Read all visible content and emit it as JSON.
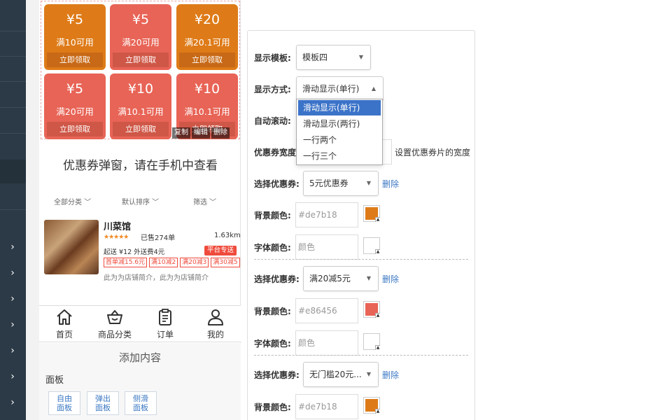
{
  "sidebar": {
    "chevrons": [
      "›",
      "›",
      "›",
      "›",
      "›",
      "›",
      "›",
      "›"
    ]
  },
  "coupons": [
    {
      "amount": "¥5",
      "condition": "满10可用",
      "button": "立即领取",
      "color": "#de7b18"
    },
    {
      "amount": "¥5",
      "condition": "满20可用",
      "button": "立即领取",
      "color": "#e86456"
    },
    {
      "amount": "¥20",
      "condition": "满20.1可用",
      "button": "立即领取",
      "color": "#de7b18"
    },
    {
      "amount": "¥5",
      "condition": "满20可用",
      "button": "立即领取",
      "color": "#e86456"
    },
    {
      "amount": "¥10",
      "condition": "满10.1可用",
      "button": "立即领取",
      "color": "#e86456"
    },
    {
      "amount": "¥10",
      "condition": "满10.1可用",
      "button": "立即领取",
      "color": "#e86456"
    }
  ],
  "edit_tools": {
    "copy": "复制",
    "edit": "编辑",
    "delete": "删除"
  },
  "popup_notice": "优惠券弹窗，请在手机中查看",
  "filters": {
    "category": "全部分类",
    "sort": "默认排序",
    "filter": "筛选"
  },
  "shop": {
    "name": "川菜馆",
    "stars": "★★★★★",
    "sold": "已售274单",
    "distance": "1.63km",
    "delivery": "起送 ¥12  外送费4元",
    "badge": "平台专送",
    "tags": [
      "首单减15.6元",
      "满10减2",
      "满20减3",
      "满30减5"
    ],
    "intro": "此为为店铺简介，此为为店铺简介"
  },
  "tabbar": [
    {
      "label": "首页",
      "icon": "home-icon"
    },
    {
      "label": "商品分类",
      "icon": "basket-icon"
    },
    {
      "label": "订单",
      "icon": "clipboard-icon"
    },
    {
      "label": "我的",
      "icon": "user-icon"
    }
  ],
  "add_panel": {
    "title": "添加内容",
    "section": "面板",
    "buttons": [
      "自由\n面板",
      "弹出\n面板",
      "侧滑\n面板"
    ]
  },
  "settings": {
    "template_label": "显示模板:",
    "template_value": "模板四",
    "display_label": "显示方式:",
    "display_value": "滑动显示(单行)",
    "display_options": [
      "滑动显示(单行)",
      "滑动显示(两行)",
      "一行两个",
      "一行三个"
    ],
    "autoscroll_label": "自动滚动:",
    "width_label": "优惠券宽度",
    "width_hint": "设置优惠券片的宽度",
    "groups": [
      {
        "select_label": "选择优惠券:",
        "coupon": "5元优惠券",
        "delete": "删除",
        "bg_label": "背景颜色:",
        "bg_value": "#de7b18",
        "bg_color": "#de7b18",
        "font_label": "字体颜色:",
        "font_placeholder": "颜色"
      },
      {
        "select_label": "选择优惠券:",
        "coupon": "满20减5元",
        "delete": "删除",
        "bg_label": "背景颜色:",
        "bg_value": "#e86456",
        "bg_color": "#e86456",
        "font_label": "字体颜色:",
        "font_placeholder": "颜色"
      },
      {
        "select_label": "选择优惠券:",
        "coupon": "无门槛20元...",
        "delete": "删除",
        "bg_label": "背景颜色:",
        "bg_value": "#de7b18",
        "bg_color": "#de7b18"
      }
    ]
  }
}
